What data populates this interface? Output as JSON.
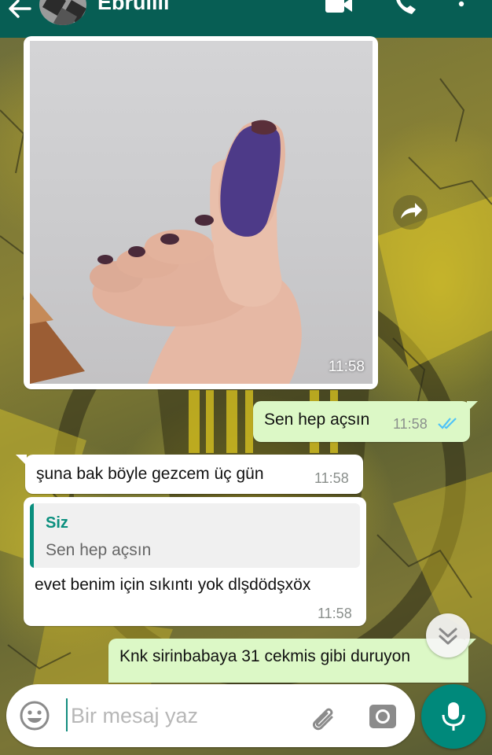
{
  "contact": {
    "name": "Ebrulili"
  },
  "colors": {
    "header": "#075e54",
    "outgoing_bubble": "#dcf8c6",
    "incoming_bubble": "#ffffff",
    "accent": "#00897b",
    "read_ticks": "#4fc3f7"
  },
  "icons": {
    "back": "arrow-left-icon",
    "video": "video-camera-icon",
    "call": "phone-icon",
    "menu": "more-vertical-icon",
    "forward": "forward-arrow-icon",
    "scroll": "double-chevron-down-icon",
    "emoji": "emoji-icon",
    "attach": "paperclip-icon",
    "camera": "camera-icon",
    "mic": "microphone-icon"
  },
  "messages": [
    {
      "type": "image",
      "direction": "in",
      "time": "11:58"
    },
    {
      "type": "text",
      "direction": "out",
      "text": "Sen hep açsın",
      "time": "11:58",
      "status": "read"
    },
    {
      "type": "text",
      "direction": "in",
      "text": "şuna bak böyle gezcem üç gün",
      "time": "11:58"
    },
    {
      "type": "reply",
      "direction": "in",
      "quote": {
        "author": "Siz",
        "text": "Sen hep açsın"
      },
      "text": "evet benim için sıkıntı yok dlşdödşxöx",
      "time": "11:58"
    },
    {
      "type": "text",
      "direction": "out",
      "text": "Knk sirinbabaya 31 cekmis gibi duruyon"
    }
  ],
  "composer": {
    "placeholder": "Bir mesaj yaz",
    "value": ""
  }
}
